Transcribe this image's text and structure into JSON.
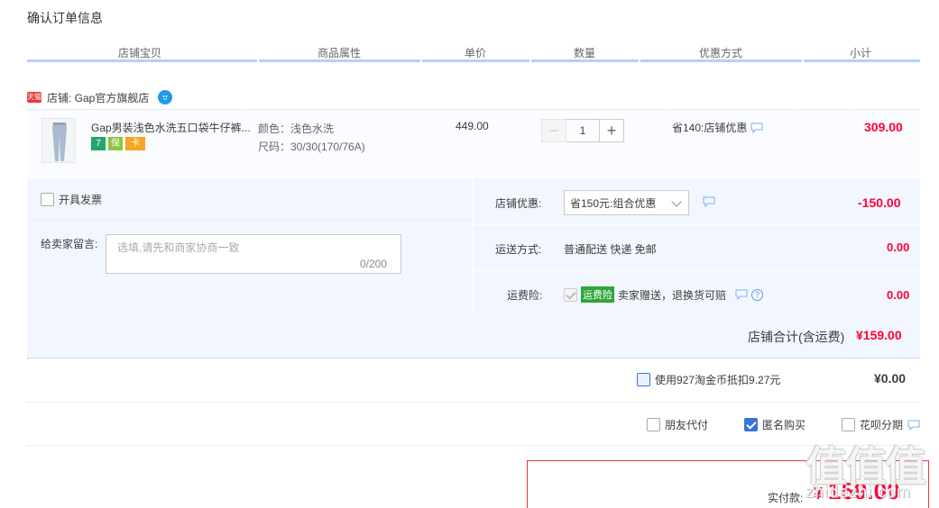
{
  "page_title": "确认订单信息",
  "columns": [
    "店铺宝贝",
    "商品属性",
    "单价",
    "数量",
    "优惠方式",
    "小计"
  ],
  "shop": {
    "badge": "天猫",
    "name": "店铺: Gap官方旗舰店"
  },
  "item": {
    "title": "Gap男装浅色水洗五口袋牛仔裤...",
    "service_icons": [
      "7",
      "保",
      "卡"
    ],
    "attr_color": "颜色：浅色水洗",
    "attr_size": "尺码：30/30(170/76A)",
    "price": "449.00",
    "qty_minus": "−",
    "qty": "1",
    "qty_plus": "+",
    "promo": "省140:店铺优惠",
    "subtotal": "309.00"
  },
  "invoice_label": "开具发票",
  "message": {
    "label": "给卖家留言:",
    "placeholder": "选填,请先和商家协商一致",
    "count": "0/200"
  },
  "shop_discount": {
    "label": "店铺优惠:",
    "selected": "省150元:组合优惠",
    "value": "-150.00"
  },
  "shipping": {
    "label": "运送方式:",
    "method": "普通配送 快递 免邮",
    "value": "0.00"
  },
  "insurance": {
    "label": "运费险:",
    "badge": "运费险",
    "desc": "卖家赠送，退换货可赔",
    "help": "?",
    "value": "0.00"
  },
  "shop_total": {
    "label": "店铺合计(含运费)",
    "value": "¥159.00"
  },
  "coin": {
    "label": "使用927淘金币抵扣9.27元",
    "value": "¥0.00"
  },
  "options": {
    "friend_pay": "朋友代付",
    "anonymous": "匿名购买",
    "huabei": "花呗分期"
  },
  "pay": {
    "label": "实付款:",
    "currency": "¥",
    "amount": "159.00"
  },
  "watermark": {
    "text": "值值值",
    "url": "zhidezhi.com"
  },
  "colors": {
    "accent_red": "#ff0036",
    "header_line": "#b2d1ff",
    "panel_bg": "#f2f7ff",
    "tmall_red": "#e4393c"
  }
}
